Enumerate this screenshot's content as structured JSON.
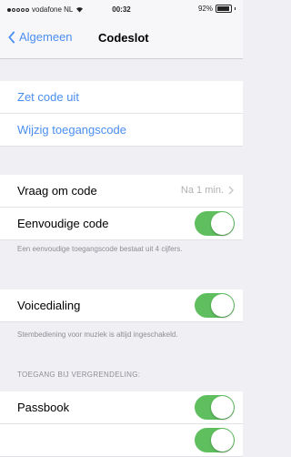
{
  "status_bar": {
    "carrier": "vodafone NL",
    "time": "00:32",
    "battery": "92%",
    "battery_level": 0.92
  },
  "nav": {
    "back_label": "Algemeen",
    "title": "Codeslot"
  },
  "actions": {
    "disable_code": "Zet code uit",
    "change_code": "Wijzig toegangscode"
  },
  "settings": {
    "require_code": {
      "label": "Vraag om code",
      "value": "Na 1 min."
    },
    "simple_code": {
      "label": "Eenvoudige code",
      "on": true
    },
    "simple_code_note": "Een eenvoudige toegangscode bestaat uit 4 cijfers.",
    "voice_dial": {
      "label": "Voicedialing",
      "on": true
    },
    "voice_dial_note": "Stembediening voor muziek is altijd ingeschakeld."
  },
  "lock_access": {
    "header": "TOEGANG BIJ VERGRENDELING:",
    "items": [
      {
        "label": "Passbook",
        "on": true
      }
    ]
  },
  "colors": {
    "accent": "#4a8ef1",
    "toggle_on": "#5fbf5f",
    "background": "#efeff4"
  }
}
